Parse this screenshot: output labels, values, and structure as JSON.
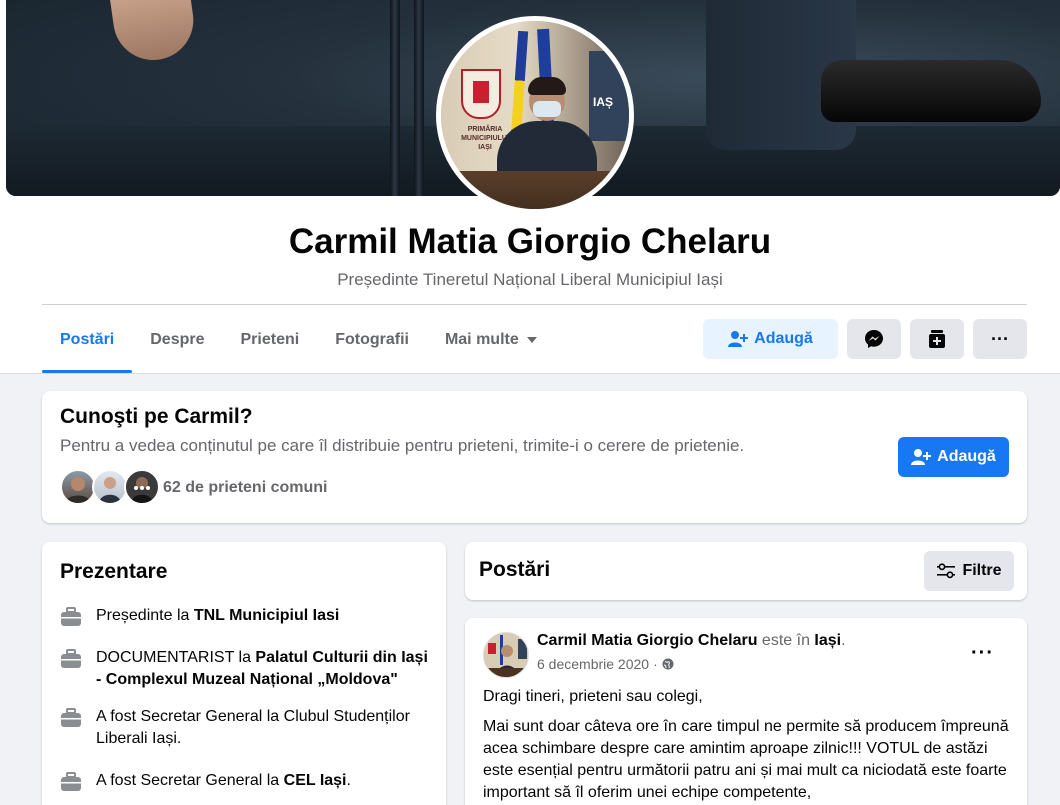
{
  "profile": {
    "name": "Carmil Matia Giorgio Chelaru",
    "bio": "Președinte Tineretul Național Liberal Municipiul Iași",
    "avatar_text": "PRIMĂRIA MUNICIPIULUI IAȘI",
    "poster_text": "IAȘ"
  },
  "tabs": [
    {
      "label": "Postări",
      "active": true
    },
    {
      "label": "Despre"
    },
    {
      "label": "Prieteni"
    },
    {
      "label": "Fotografii"
    },
    {
      "label": "Mai multe"
    }
  ],
  "actions": {
    "add_friend_label": "Adaugă",
    "icons": [
      "messenger-icon",
      "stories-icon",
      "more-icon"
    ],
    "more_glyph": "···"
  },
  "know_card": {
    "title": "Cunoşti pe Carmil?",
    "description": "Pentru a vedea conținutul pe care îl distribuie pentru prieteni, trimite-i o cerere de prietenie.",
    "mutual_friends": "62 de prieteni comuni",
    "button_label": "Adaugă"
  },
  "intro": {
    "title": "Prezentare",
    "items": [
      {
        "prefix": "Președinte la ",
        "bold": "TNL Municipiul Iasi",
        "suffix": ""
      },
      {
        "prefix": "DOCUMENTARIST la ",
        "bold": "Palatul Culturii din Iași - Complexul Muzeal Național „Moldova\"",
        "suffix": ""
      },
      {
        "prefix": "A fost Secretar General la Clubul Studenților Liberali Iași.",
        "bold": "",
        "suffix": ""
      },
      {
        "prefix": "A fost Secretar General la ",
        "bold": "CEL Iași",
        "suffix": "."
      }
    ]
  },
  "posts_section": {
    "title": "Postări",
    "filter_label": "Filtre"
  },
  "post": {
    "author": "Carmil Matia Giorgio Chelaru",
    "location_prefix": " este în ",
    "location": "Iași",
    "location_suffix": ".",
    "date": "6 decembrie 2020",
    "meta_separator": "·",
    "more_glyph": "···",
    "paragraph1": "Dragi tineri, prieteni sau colegi,",
    "paragraph2": "Mai sunt doar câteva ore în care timpul ne permite să producem împreună acea schimbare despre care amintim aproape zilnic!!! VOTUL de astăzi este esențial pentru următorii patru ani și mai mult ca niciodată este foarte important să îl oferim  unei echipe competente,"
  },
  "colors": {
    "accent": "#1877f2",
    "accent_light": "#e7f3ff",
    "secondary_text": "#65676b",
    "page_bg": "#f0f2f5"
  }
}
